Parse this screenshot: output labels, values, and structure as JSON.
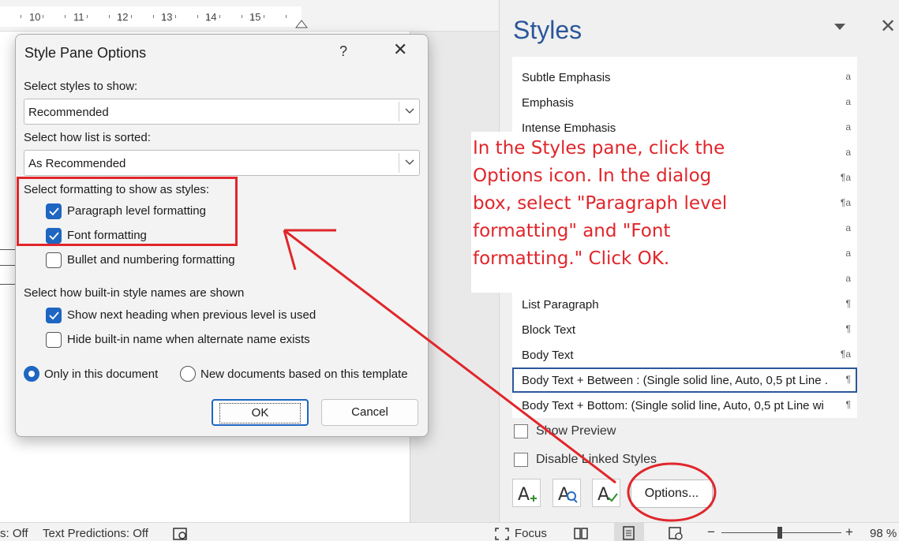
{
  "ruler": {
    "numbers": [
      "10",
      "11",
      "12",
      "13",
      "14",
      "15"
    ]
  },
  "styles_pane": {
    "title": "Styles",
    "close_glyph": "✕",
    "styles": [
      {
        "name": "Subtle Emphasis",
        "marker": "a"
      },
      {
        "name": "Emphasis",
        "marker": "a"
      },
      {
        "name": "Intense Emphasis",
        "marker": "a"
      },
      {
        "name": "",
        "marker": "a"
      },
      {
        "name": "",
        "marker": "¶a"
      },
      {
        "name": "",
        "marker": "¶a"
      },
      {
        "name": "",
        "marker": "a"
      },
      {
        "name": "",
        "marker": "a"
      },
      {
        "name": "",
        "marker": "a"
      },
      {
        "name": "List Paragraph",
        "marker": "¶"
      },
      {
        "name": "Block Text",
        "marker": "¶"
      },
      {
        "name": "Body Text",
        "marker": "¶a"
      },
      {
        "name": "Body Text + Between : (Single solid line, Auto,  0,5 pt Line .",
        "marker": "¶",
        "selected": true
      },
      {
        "name": "Body Text + Bottom: (Single solid line, Auto,  0,5 pt Line wi",
        "marker": "¶"
      }
    ],
    "show_preview_label": "Show Preview",
    "show_preview_checked": false,
    "disable_linked_label": "Disable Linked Styles",
    "disable_linked_checked": false,
    "options_label": "Options...",
    "accent_color": "#2b579a"
  },
  "annotation": {
    "text": "In the Styles pane, click the Options icon. In the dialog box, select \"Paragraph level formatting\" and \"Font formatting.\" Click OK.",
    "color": "#e0262b"
  },
  "dialog": {
    "title": "Style Pane Options",
    "help_glyph": "?",
    "close_glyph": "✕",
    "select_styles_label": "Select styles to show:",
    "select_styles_value": "Recommended",
    "sort_label": "Select how list is sorted:",
    "sort_value": "As Recommended",
    "formatting_label": "Select formatting to show as styles:",
    "paragraph_level": {
      "label": "Paragraph level formatting",
      "checked": true
    },
    "font_formatting": {
      "label": "Font formatting",
      "checked": true
    },
    "bullet_numbering": {
      "label": "Bullet and numbering formatting",
      "checked": false
    },
    "builtin_label": "Select how built-in style names are shown",
    "show_next_heading": {
      "label": "Show next heading when previous level is used",
      "checked": true
    },
    "hide_builtin": {
      "label": "Hide built-in name when alternate name exists",
      "checked": false
    },
    "radio_only_doc": {
      "label": "Only in this document",
      "selected": true
    },
    "radio_new_docs": {
      "label": "New documents based on this template",
      "selected": false
    },
    "ok_label": "OK",
    "cancel_label": "Cancel",
    "accent_color": "#1e66c1"
  },
  "status_bar": {
    "left_cut": "s: Off",
    "text_predictions": "Text Predictions: Off",
    "focus": "Focus",
    "zoom_minus": "−",
    "zoom_plus": "+",
    "zoom_level": "98 %"
  }
}
